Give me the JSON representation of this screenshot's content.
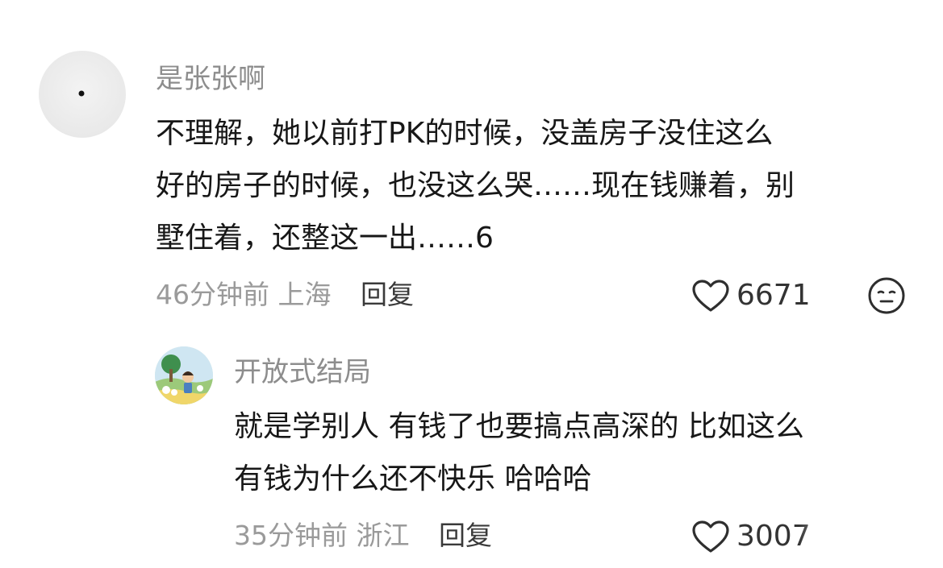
{
  "comments": [
    {
      "username": "是张张啊",
      "lines": [
        "不理解，她以前打PK的时候，没盖房子没住这么",
        "好的房子的时候，也没这么哭……现在钱赚着，别",
        "墅住着，还整这一出……6"
      ],
      "time": "46分钟前",
      "location": "上海",
      "reply_label": "回复",
      "likes": "6671"
    },
    {
      "username": "开放式结局",
      "lines": [
        "就是学别人 有钱了也要搞点高深的 比如这么",
        "有钱为什么还不快乐 哈哈哈"
      ],
      "time": "35分钟前",
      "location": "浙江",
      "reply_label": "回复",
      "likes": "3007"
    }
  ],
  "icons": {
    "like": "heart-outline-icon",
    "reaction": "face-neutral-icon"
  },
  "colors": {
    "username": "#8d8d8d",
    "meta": "#9a9a9a",
    "text": "#171717"
  }
}
